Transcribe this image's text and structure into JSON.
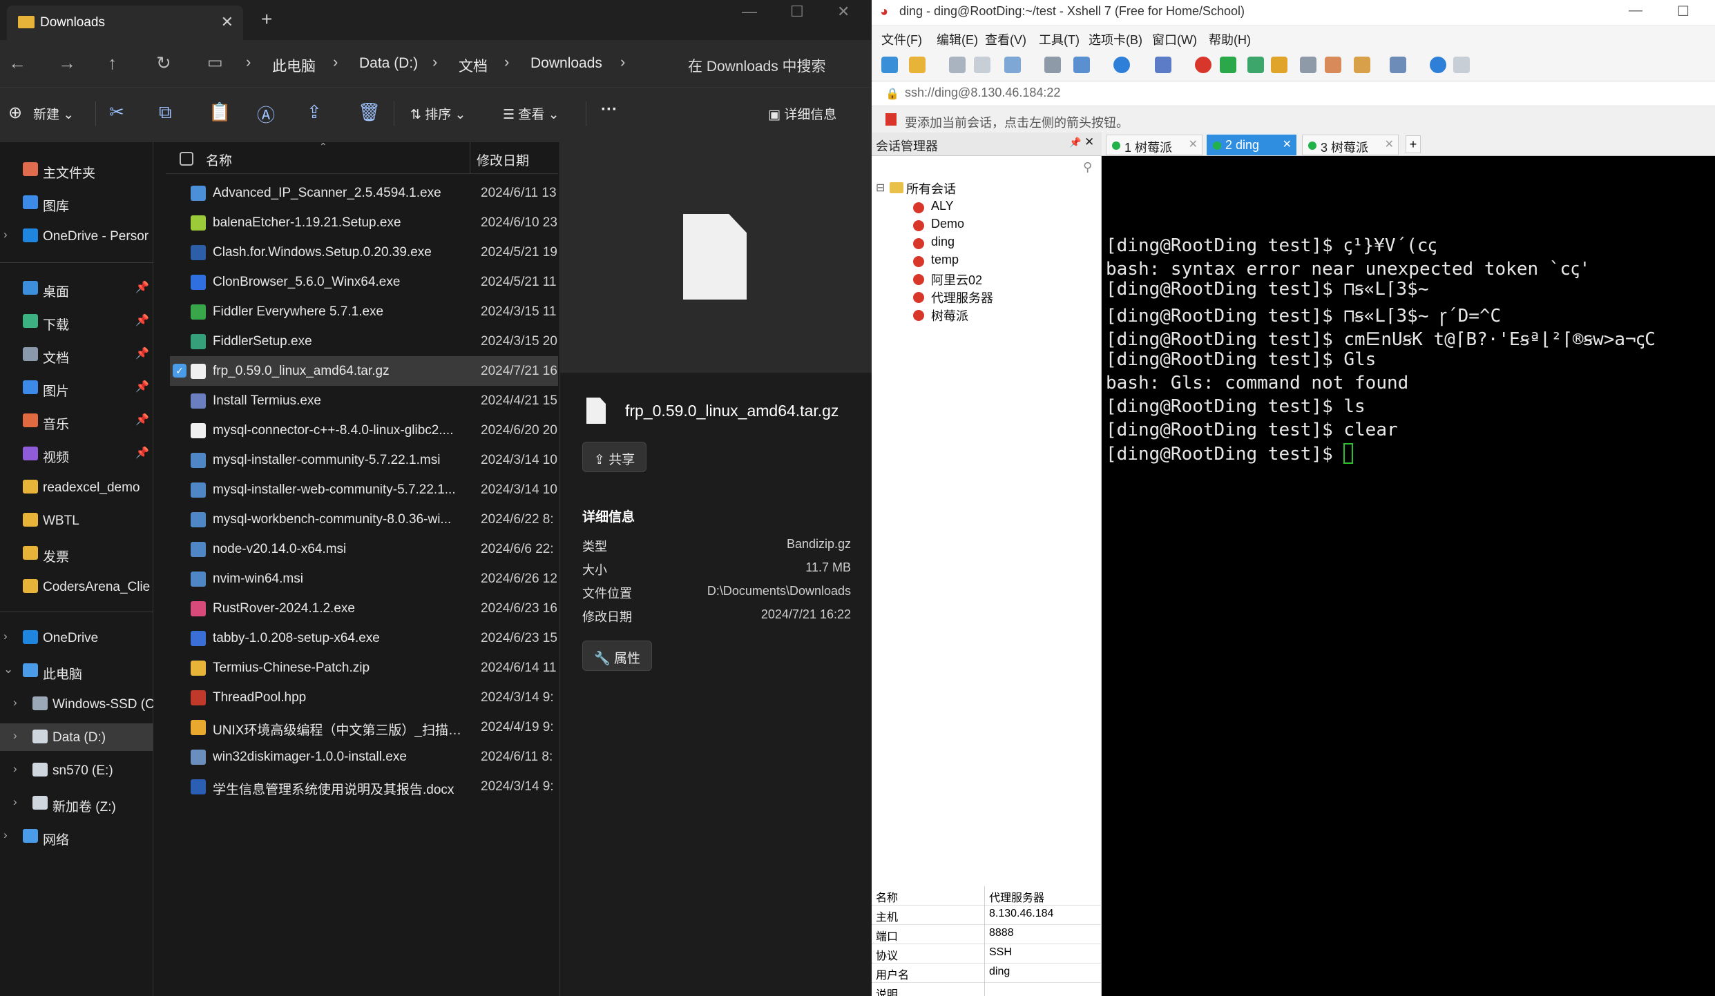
{
  "explorer": {
    "tab_title": "Downloads",
    "tab_close": "✕",
    "tab_add": "+",
    "breadcrumb": [
      "此电脑",
      "Data (D:)",
      "文档",
      "Downloads"
    ],
    "search_placeholder": "在 Downloads 中搜索",
    "toolbar": {
      "new_label": "新建",
      "sort_label": "排序",
      "view_label": "查看",
      "more_label": "···",
      "details_label": "详细信息"
    },
    "sidebar": {
      "group1": [
        {
          "label": "主文件夹",
          "icon": "home-icon",
          "color": "#e06b4d"
        },
        {
          "label": "图库",
          "icon": "gallery-icon",
          "color": "#3d8be8"
        },
        {
          "label": "OneDrive - Persor",
          "icon": "onedrive-icon",
          "color": "#1f86e0"
        }
      ],
      "pinned": [
        {
          "label": "桌面",
          "icon": "desktop-icon",
          "color": "#3b8fdc"
        },
        {
          "label": "下载",
          "icon": "download-icon",
          "color": "#3bb27f"
        },
        {
          "label": "文档",
          "icon": "documents-icon",
          "color": "#8a9aac"
        },
        {
          "label": "图片",
          "icon": "pictures-icon",
          "color": "#3d8be8"
        },
        {
          "label": "音乐",
          "icon": "music-icon",
          "color": "#e26a41"
        },
        {
          "label": "视频",
          "icon": "videos-icon",
          "color": "#8e5cd9"
        }
      ],
      "folders": [
        {
          "label": "readexcel_demo"
        },
        {
          "label": "WBTL"
        },
        {
          "label": "发票"
        },
        {
          "label": "CodersArena_Clie"
        }
      ],
      "tree": [
        {
          "label": "OneDrive",
          "icon": "onedrive-icon",
          "color": "#1f86e0",
          "exp": "›",
          "indent": 0
        },
        {
          "label": "此电脑",
          "icon": "pc-icon",
          "color": "#4a9ce8",
          "exp": "⌄",
          "indent": 0
        },
        {
          "label": "Windows-SSD (C",
          "icon": "drive-icon",
          "color": "#9aa8b8",
          "exp": "›",
          "indent": 1
        },
        {
          "label": "Data (D:)",
          "icon": "drive-icon",
          "color": "#cfd6de",
          "exp": "›",
          "indent": 1,
          "selected": true
        },
        {
          "label": "sn570 (E:)",
          "icon": "drive-icon",
          "color": "#cfd6de",
          "exp": "›",
          "indent": 1
        },
        {
          "label": "新加卷 (Z:)",
          "icon": "drive-icon",
          "color": "#cfd6de",
          "exp": "›",
          "indent": 1
        },
        {
          "label": "网络",
          "icon": "network-icon",
          "color": "#4a9ce8",
          "exp": "›",
          "indent": 0
        }
      ]
    },
    "columns": {
      "name": "名称",
      "date": "修改日期"
    },
    "files": [
      {
        "name": "Advanced_IP_Scanner_2.5.4594.1.exe",
        "date": "2024/6/11 13",
        "color": "#4a8fd8"
      },
      {
        "name": "balenaEtcher-1.19.21.Setup.exe",
        "date": "2024/6/10 23",
        "color": "#9ccb3a"
      },
      {
        "name": "Clash.for.Windows.Setup.0.20.39.exe",
        "date": "2024/5/21 19",
        "color": "#2d5fa8"
      },
      {
        "name": "ClonBrowser_5.6.0_Winx64.exe",
        "date": "2024/5/21 11",
        "color": "#2f6fe0"
      },
      {
        "name": "Fiddler Everywhere 5.7.1.exe",
        "date": "2024/3/15 11",
        "color": "#3aa64a"
      },
      {
        "name": "FiddlerSetup.exe",
        "date": "2024/3/15 20",
        "color": "#35a07a"
      },
      {
        "name": "frp_0.59.0_linux_amd64.tar.gz",
        "date": "2024/7/21 16",
        "color": "#f0f0f0",
        "selected": true
      },
      {
        "name": "Install Termius.exe",
        "date": "2024/4/21 15",
        "color": "#6b7ec0"
      },
      {
        "name": "mysql-connector-c++-8.4.0-linux-glibc2....",
        "date": "2024/6/20 20",
        "color": "#f0f0f0"
      },
      {
        "name": "mysql-installer-community-5.7.22.1.msi",
        "date": "2024/3/14 10",
        "color": "#4f86c6"
      },
      {
        "name": "mysql-installer-web-community-5.7.22.1...",
        "date": "2024/3/14 10",
        "color": "#4f86c6"
      },
      {
        "name": "mysql-workbench-community-8.0.36-wi...",
        "date": "2024/6/22 8:",
        "color": "#4f86c6"
      },
      {
        "name": "node-v20.14.0-x64.msi",
        "date": "2024/6/6 22:",
        "color": "#4f86c6"
      },
      {
        "name": "nvim-win64.msi",
        "date": "2024/6/26 12",
        "color": "#4f86c6"
      },
      {
        "name": "RustRover-2024.1.2.exe",
        "date": "2024/6/23 16",
        "color": "#d84a7a"
      },
      {
        "name": "tabby-1.0.208-setup-x64.exe",
        "date": "2024/6/23 15",
        "color": "#3b6fd8"
      },
      {
        "name": "Termius-Chinese-Patch.zip",
        "date": "2024/6/14 11",
        "color": "#e8b339"
      },
      {
        "name": "ThreadPool.hpp",
        "date": "2024/3/14 9:",
        "color": "#c0392b"
      },
      {
        "name": "UNIX环境高级编程（中文第三版）_扫描版 (...",
        "date": "2024/4/19 9:",
        "color": "#e8a92e"
      },
      {
        "name": "win32diskimager-1.0.0-install.exe",
        "date": "2024/6/11 8:",
        "color": "#6a8fbf"
      },
      {
        "name": "学生信息管理系统使用说明及其报告.docx",
        "date": "2024/3/14 9:",
        "color": "#2b5fb4"
      }
    ],
    "preview": {
      "filename": "frp_0.59.0_linux_amd64.tar.gz",
      "share_label": "共享",
      "details_header": "详细信息",
      "details": [
        {
          "k": "类型",
          "v": "Bandizip.gz"
        },
        {
          "k": "大小",
          "v": "11.7 MB"
        },
        {
          "k": "文件位置",
          "v": "D:\\Documents\\Downloads"
        },
        {
          "k": "修改日期",
          "v": "2024/7/21 16:22"
        }
      ],
      "properties_label": "属性"
    }
  },
  "xshell": {
    "title": "ding - ding@RootDing:~/test - Xshell 7 (Free for Home/School)",
    "menu": [
      "文件(F)",
      "编辑(E)",
      "查看(V)",
      "工具(T)",
      "选项卡(B)",
      "窗口(W)",
      "帮助(H)"
    ],
    "address": "ssh://ding@8.130.46.184:22",
    "hint": "要添加当前会话，点击左侧的箭头按钮。",
    "session_manager": {
      "title": "会话管理器",
      "pin": "📌",
      "close": "✕",
      "root": "所有会话",
      "root_toggle": "⊟",
      "items": [
        "ALY",
        "Demo",
        "ding",
        "temp",
        "阿里云02",
        "代理服务器",
        "树莓派"
      ]
    },
    "properties": [
      {
        "k": "名称",
        "v": "代理服务器"
      },
      {
        "k": "主机",
        "v": "8.130.46.184"
      },
      {
        "k": "端口",
        "v": "8888"
      },
      {
        "k": "协议",
        "v": "SSH"
      },
      {
        "k": "用户名",
        "v": "ding"
      },
      {
        "k": "说明",
        "v": ""
      }
    ],
    "tabs": [
      {
        "label": "1 树莓派",
        "active": false
      },
      {
        "label": "2 ding",
        "active": true
      },
      {
        "label": "3 树莓派",
        "active": false
      }
    ],
    "tab_close": "✕",
    "tab_add": "+",
    "terminal_lines": [
      "[ding@RootDing test]$ ꞔ¹}¥V´(cꞔ",
      "bash: syntax error near unexpected token `cꞔ'",
      "[ding@RootDing test]$ ⊓ꞩ«L⌈3$~",
      "[ding@RootDing test]$ ⊓ꞩ«L⌈3$~ ꞅ´D=^C",
      "[ding@RootDing test]$ cm⋿nUꞩK t@⌈B?·'Eꞩª⌊²⌈®ꞩw>a¬ꞔC",
      "[ding@RootDing test]$ Gls",
      "bash: Gls: command not found",
      "[ding@RootDing test]$ ls",
      "[ding@RootDing test]$ clear",
      "[ding@RootDing test]$ "
    ]
  }
}
